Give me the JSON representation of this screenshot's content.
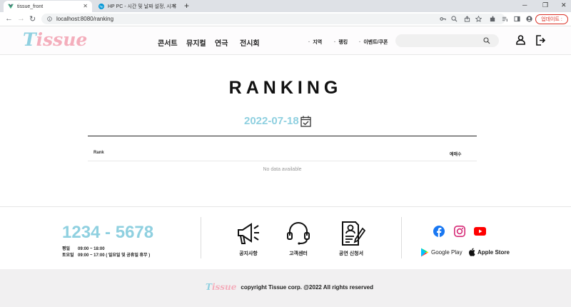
{
  "browser": {
    "tabs": [
      {
        "title": "tissue_front"
      },
      {
        "title": "HP PC - 시간 및 날짜 설정, 시계"
      }
    ],
    "url": "localhost:8080/ranking",
    "update_label": "업데이트 :"
  },
  "header": {
    "logo_initial": "T",
    "logo_rest": "issue",
    "nav": [
      "콘서트",
      "뮤지컬",
      "연극",
      "전시회"
    ],
    "subnav": [
      "지역",
      "랭킹",
      "이벤트/쿠폰"
    ],
    "search_placeholder": ""
  },
  "main": {
    "title": "RANKING",
    "date": "2022-07-18",
    "table": {
      "headers": [
        "Rank",
        "예매수"
      ],
      "empty_text": "No data available"
    }
  },
  "footer": {
    "phone": "1234 - 5678",
    "hours": [
      {
        "day": "평일",
        "time": "09:00 ~ 18:00"
      },
      {
        "day": "토요일",
        "time": "09:00 ~ 17:00 ( 일요일 및 공휴일 휴무 )"
      }
    ],
    "services": [
      {
        "label": "공지사항",
        "icon": "megaphone-icon"
      },
      {
        "label": "고객센터",
        "icon": "headset-icon"
      },
      {
        "label": "공연 신청서",
        "icon": "application-form-icon"
      }
    ],
    "stores": [
      {
        "label": "Google Play",
        "icon": "google-play-icon"
      },
      {
        "label": "Apple Store",
        "icon": "apple-icon"
      }
    ],
    "copyright": "copyright Tissue corp. @2022 All rights reserved"
  },
  "colors": {
    "brand_blue": "#8fd0e0",
    "brand_pink": "#f4aebc"
  }
}
